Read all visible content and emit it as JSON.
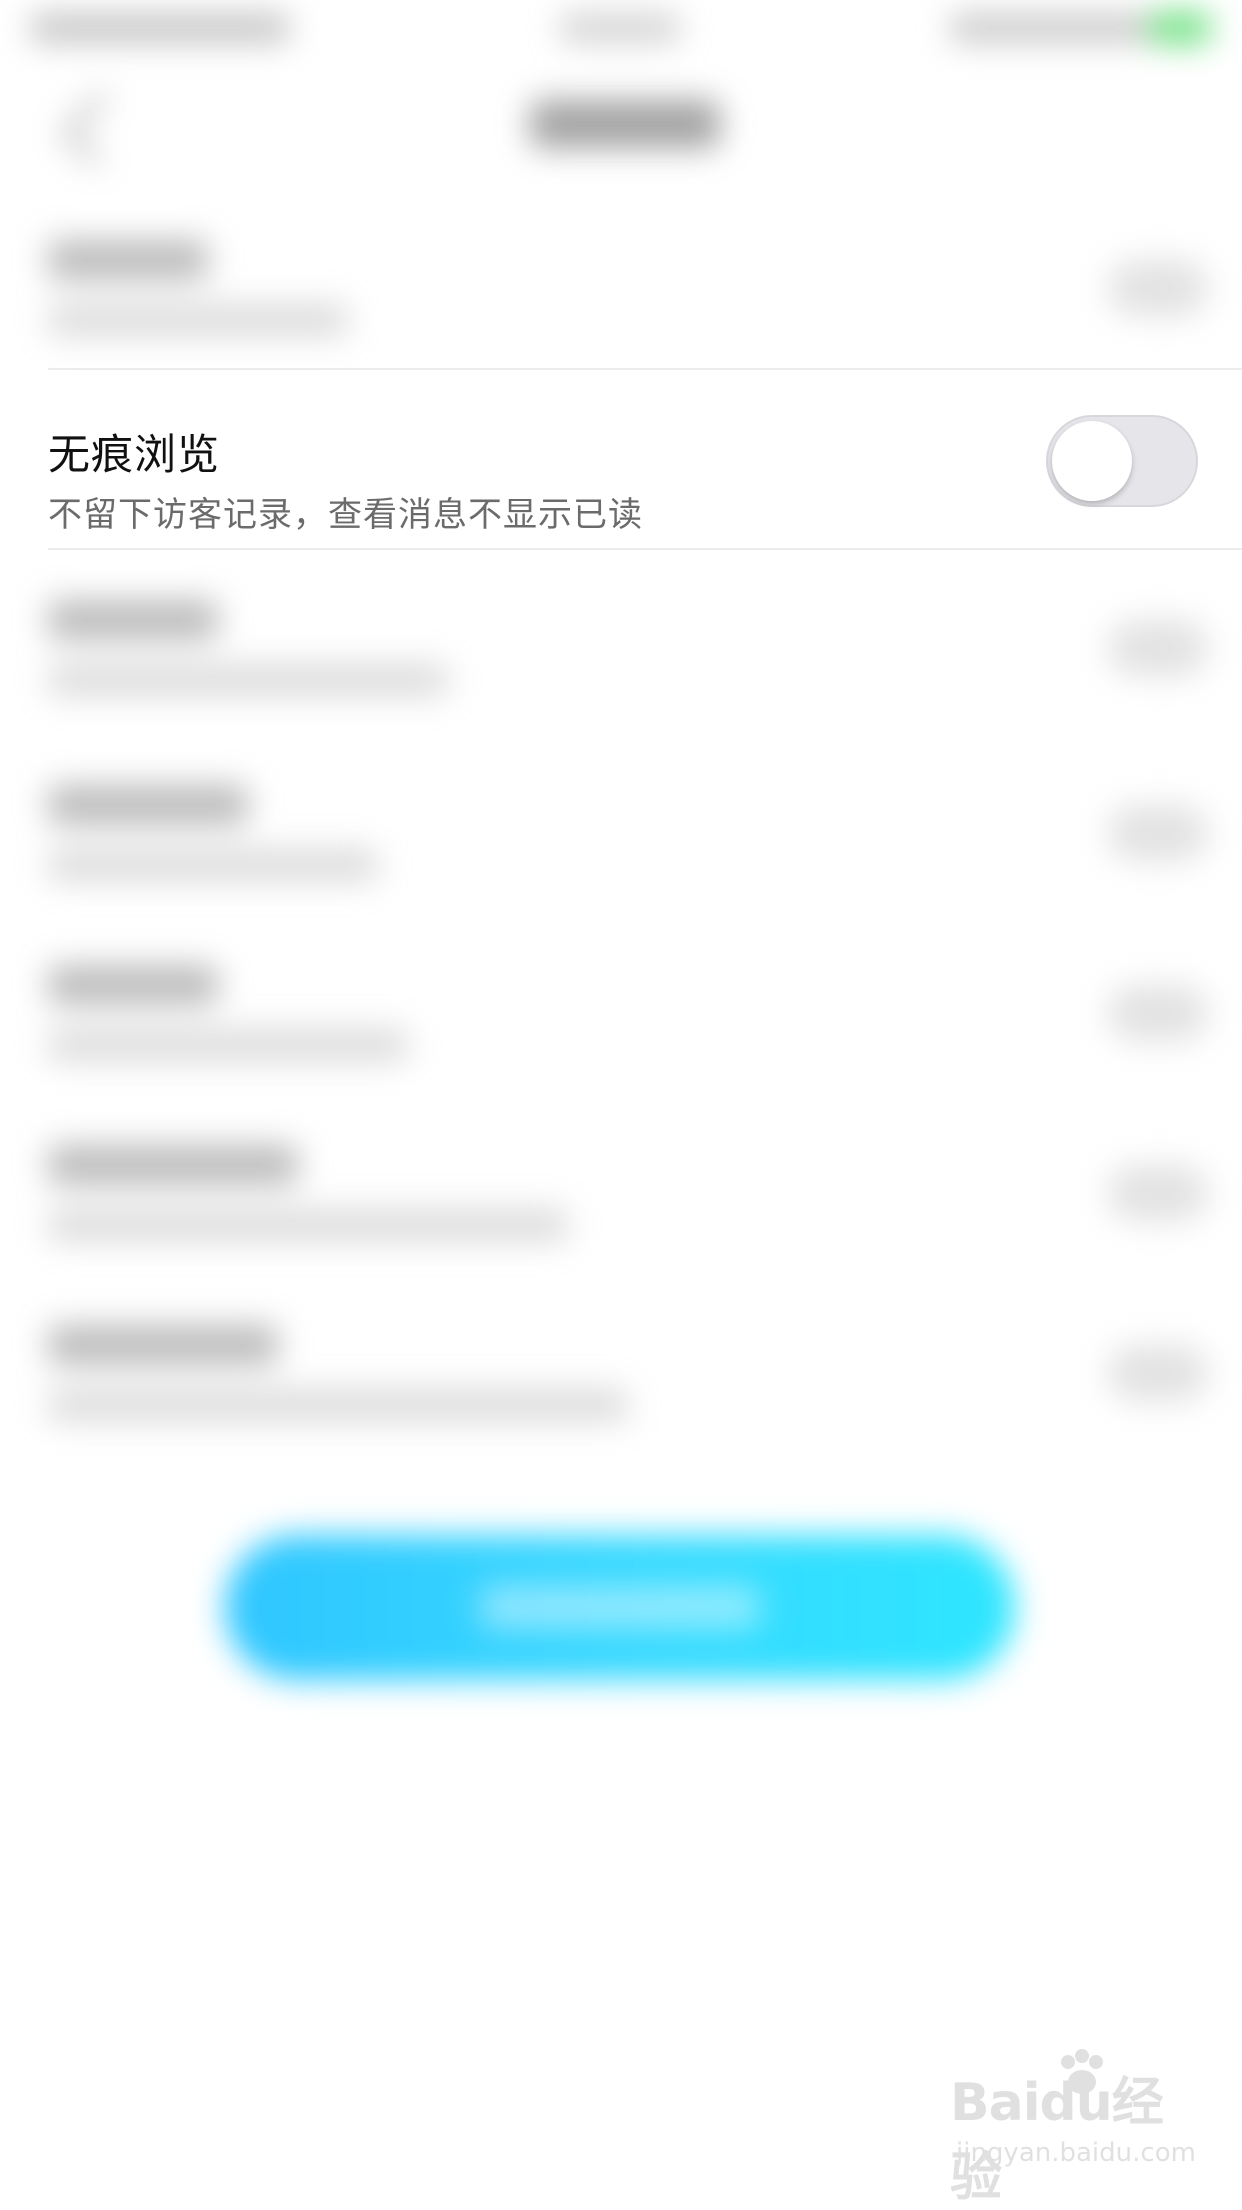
{
  "setting": {
    "title": "无痕浏览",
    "subtitle": "不留下访客记录，查看消息不显示已读",
    "enabled": false
  },
  "watermark": {
    "logo": "Baidu经验",
    "url": "jingyan.baidu.com"
  },
  "colors": {
    "accent_button": "#2fd2ff",
    "toggle_off": "#e5e5ea"
  }
}
